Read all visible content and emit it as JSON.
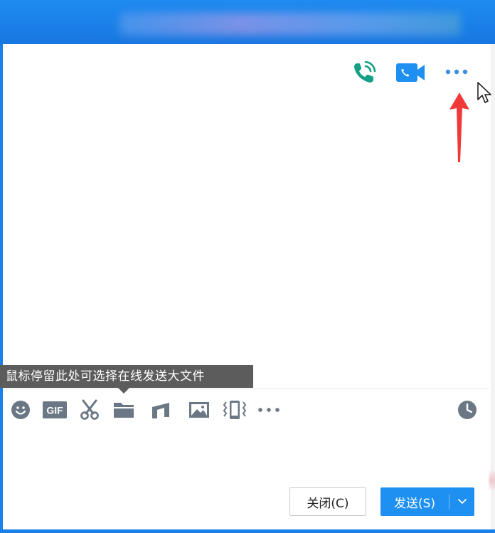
{
  "header": {
    "call_icon": "phone-call-icon",
    "video_icon": "video-call-icon",
    "more_icon": "more-horizontal-icon"
  },
  "tooltip": {
    "text": "鼠标停留此处可选择在线发送大文件"
  },
  "toolbar": {
    "items": [
      {
        "name": "emoji",
        "icon": "emoji-icon"
      },
      {
        "name": "gif",
        "icon": "gif-icon",
        "label": "GIF"
      },
      {
        "name": "screenshot",
        "icon": "scissors-icon"
      },
      {
        "name": "file",
        "icon": "folder-icon"
      },
      {
        "name": "music",
        "icon": "music-icon"
      },
      {
        "name": "image",
        "icon": "image-icon"
      },
      {
        "name": "shake",
        "icon": "shake-window-icon"
      },
      {
        "name": "more",
        "icon": "more-horizontal-icon"
      },
      {
        "name": "history",
        "icon": "clock-icon"
      }
    ]
  },
  "buttons": {
    "close_label": "关闭(C)",
    "send_label": "发送(S)"
  },
  "colors": {
    "titlebar": "#1a7fe8",
    "call_green": "#16a085",
    "video_blue": "#1e90f2",
    "icon_gray": "#6b7785",
    "send_button": "#1e90f2",
    "tooltip_bg": "#5c5c5c",
    "annotation_red": "#f03a3a"
  }
}
